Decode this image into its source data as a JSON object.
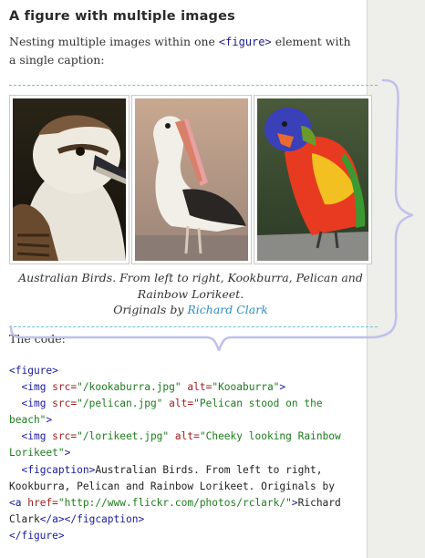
{
  "heading": "A figure with multiple images",
  "intro": {
    "before": "Nesting multiple images within one ",
    "tag": "<figure>",
    "after": " element with a single caption:"
  },
  "figure": {
    "images": [
      {
        "name": "kookaburra",
        "alt": "Kooaburra"
      },
      {
        "name": "pelican",
        "alt": "Pelican stood on the beach"
      },
      {
        "name": "lorikeet",
        "alt": "Cheeky looking Rainbow Lorikeet"
      }
    ],
    "caption_line1": "Australian Birds. From left to right, Kookburra, Pelican and Rainbow Lorikeet.",
    "caption_prefix": "Originals by ",
    "caption_link": "Richard Clark"
  },
  "code_label": "The code:",
  "code": {
    "figure_open": "<figure>",
    "img_open": "<img ",
    "src_attr": "src=",
    "alt_attr": " alt=",
    "tag_close": ">",
    "img1_src": "\"/kookaburra.jpg\"",
    "img1_alt": "\"Kooaburra\"",
    "img2_src": "\"/pelican.jpg\"",
    "img2_alt_a": "\"Pelican stood on the",
    "img2_alt_b": "beach\"",
    "img3_src": "\"/lorikeet.jpg\"",
    "img3_alt_a": "\"Cheeky looking Rainbow",
    "img3_alt_b": "Lorikeet\"",
    "figcaption_open": "<figcaption>",
    "caption_text_a": "Australian Birds. From left to right,",
    "caption_text_b": "Kookburra, Pelican and Rainbow Lorikeet. Originals by",
    "a_open": "<a ",
    "href_attr": "href=",
    "href_val": "\"http://www.flickr.com/photos/rclark/\"",
    "link_text_a": "Richard",
    "link_text_b": "Clark",
    "a_close": "</a>",
    "figcaption_close": "</figcaption>",
    "figure_close": "</figure>"
  },
  "colors": {
    "link": "#2d8fc4",
    "dashed_rule": "#6ec0d8",
    "brace": "#c0c0ec",
    "code_tag": "#1a1a9c",
    "code_attr": "#a02020",
    "code_string": "#1c7c1c"
  }
}
